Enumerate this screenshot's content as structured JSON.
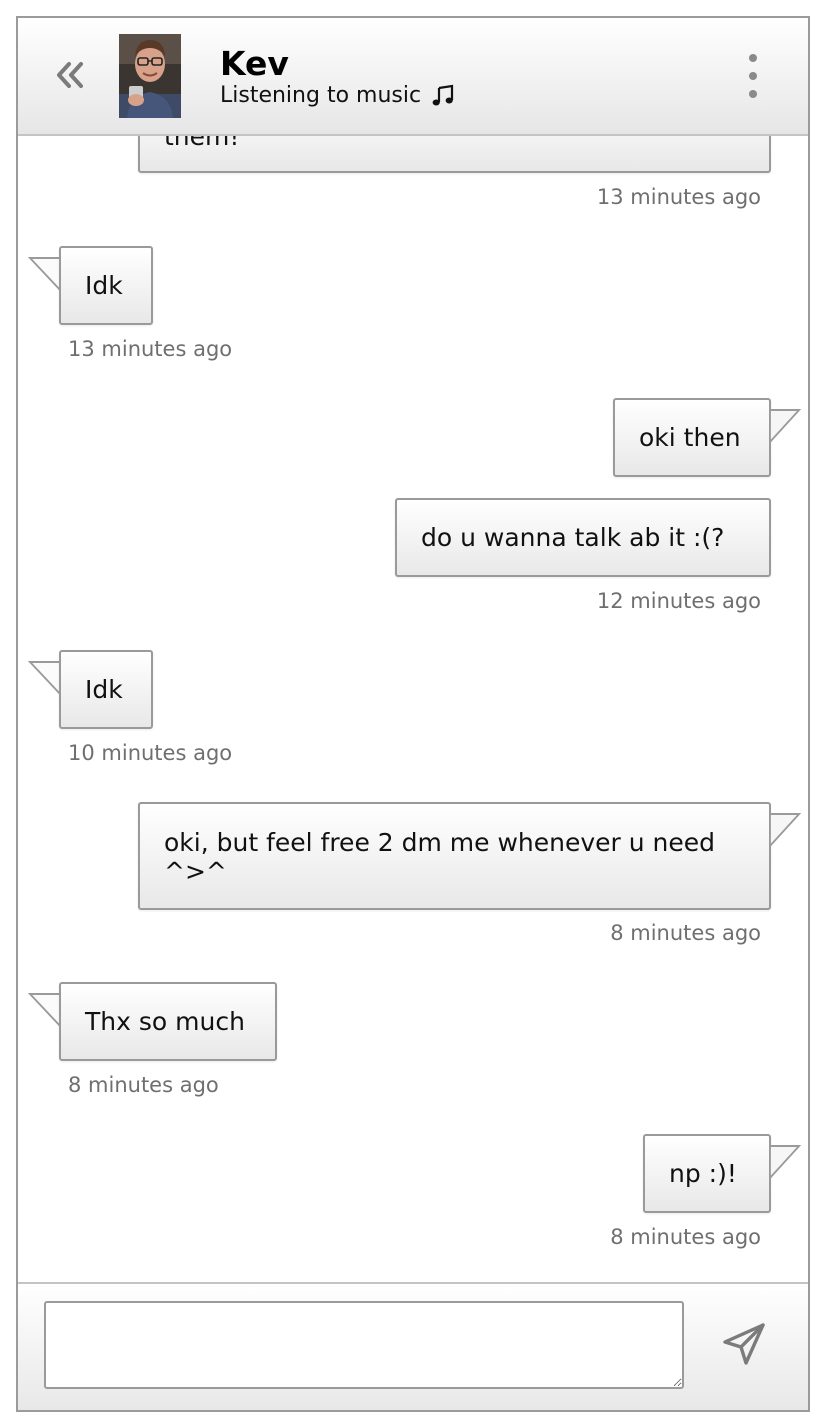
{
  "header": {
    "contact_name": "Kev",
    "contact_status": "Listening to music",
    "status_icon": "music-note-icon",
    "back_icon": "double-chevron-left-icon",
    "menu_icon": "kebab-menu-icon"
  },
  "messages": [
    {
      "side": "right",
      "text": "them!",
      "timestamp": "13 minutes ago"
    },
    {
      "side": "left",
      "text": "Idk",
      "timestamp": "13 minutes ago"
    },
    {
      "side": "right",
      "text": "oki then",
      "timestamp": ""
    },
    {
      "side": "right",
      "text": "do u wanna talk ab it :(?",
      "timestamp": "12 minutes ago"
    },
    {
      "side": "left",
      "text": "Idk",
      "timestamp": "10 minutes ago"
    },
    {
      "side": "right",
      "text": "oki, but feel free 2 dm me whenever u need ^>^",
      "timestamp": "8 minutes ago"
    },
    {
      "side": "left",
      "text": "Thx so much",
      "timestamp": "8 minutes ago"
    },
    {
      "side": "right",
      "text": "np :)!",
      "timestamp": "8 minutes ago"
    }
  ],
  "composer": {
    "input_value": "",
    "placeholder": "",
    "send_icon": "send-icon"
  },
  "colors": {
    "bubble_border": "#9a9a9a",
    "timestamp": "#6f6f6f",
    "header_gradient_end": "#e6e6e6"
  }
}
